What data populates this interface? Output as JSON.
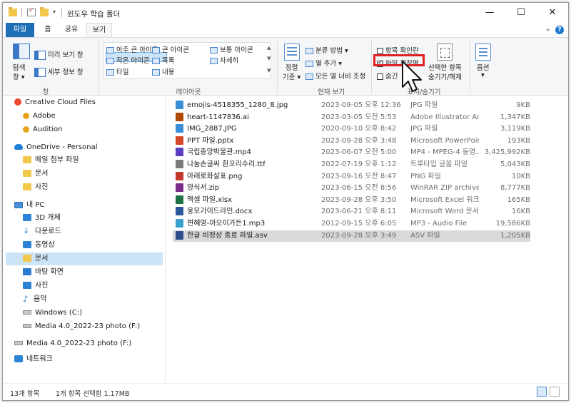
{
  "window": {
    "title": "윈도우 학습 폴더",
    "minimize": "—",
    "maximize": "☐",
    "close": "✕"
  },
  "tabs": [
    {
      "label": "파일"
    },
    {
      "label": "홈"
    },
    {
      "label": "공유"
    },
    {
      "label": "보기"
    }
  ],
  "ribbon": {
    "pane": {
      "nav_pane": "탐색",
      "nav_pane2": "창",
      "preview": "미리 보기 창",
      "details": "세부 정보 창",
      "group": "창"
    },
    "layout": {
      "items": [
        "아주 큰 아이콘",
        "큰 아이콘",
        "보통 아이콘",
        "작은 아이콘",
        "목록",
        "자세히",
        "타일",
        "내용"
      ],
      "selected": "자세히",
      "group": "레이아웃"
    },
    "current_view": {
      "sort": "정렬",
      "sort2": "기준",
      "group_by": "분류 방법",
      "add_col": "열 추가",
      "fit_cols": "모든 열 너비 조정",
      "group": "현재 보기"
    },
    "show_hide": {
      "item_checkboxes": "항목 확인란",
      "file_ext": "파일 확장명",
      "hidden": "숨긴",
      "hide_selected": "선택한 항목",
      "hide_selected2": "숨기기/해제",
      "group": "표시/숨기기",
      "group_partial": "표시",
      "group_partial2": "숨기기"
    },
    "options": "옵션"
  },
  "nav": {
    "items": [
      {
        "label": "Creative Cloud Files"
      },
      {
        "label": "Adobe"
      },
      {
        "label": "Audition"
      },
      {
        "label": "OneDrive - Personal"
      },
      {
        "label": "메일 첨부 파일"
      },
      {
        "label": "문서"
      },
      {
        "label": "사진"
      },
      {
        "label": "내 PC"
      },
      {
        "label": "3D 개체"
      },
      {
        "label": "다운로드"
      },
      {
        "label": "동영상"
      },
      {
        "label": "문서"
      },
      {
        "label": "바탕 화면"
      },
      {
        "label": "사진"
      },
      {
        "label": "음악"
      },
      {
        "label": "Windows (C:)"
      },
      {
        "label": "Media 4.0_2022-23 photo (F:)"
      },
      {
        "label": "Media 4.0_2022-23 photo (F:)"
      },
      {
        "label": "네트워크"
      }
    ]
  },
  "files": [
    {
      "name": "emojis-4518355_1280_8.jpg",
      "date": "2023-09-05 오후 12:36",
      "type": "JPG 파일",
      "size": "9KB",
      "color": "#3b8fd9"
    },
    {
      "name": "heart-1147836.ai",
      "date": "2023-03-05 오전 5:53",
      "type": "Adobe Illustrator Art...",
      "size": "1,347KB",
      "color": "#b04a00"
    },
    {
      "name": "IMG_2887.JPG",
      "date": "2020-09-10 오후 8:42",
      "type": "JPG 파일",
      "size": "3,119KB",
      "color": "#3b8fd9"
    },
    {
      "name": "PPT 파일.pptx",
      "date": "2023-09-28 오후 3:48",
      "type": "Microsoft PowerPoin...",
      "size": "193KB",
      "color": "#d24726"
    },
    {
      "name": "국립중앙박물관.mp4",
      "date": "2023-06-07 오전 5:00",
      "type": "MP4 - MPEG-4 동영...",
      "size": "3,425,992KB",
      "color": "#5a3fc0"
    },
    {
      "name": "나눔손글씨 흰꼬리수리.ttf",
      "date": "2022-07-19 오후 1:12",
      "type": "트루타입 글꼴 파일",
      "size": "5,043KB",
      "color": "#7a7a7a"
    },
    {
      "name": "아래로화살표.png",
      "date": "2023-09-16 오전 8:47",
      "type": "PNG 파일",
      "size": "10KB",
      "color": "#c0392b"
    },
    {
      "name": "양식서.zip",
      "date": "2023-06-15 오전 8:56",
      "type": "WinRAR ZIP archive",
      "size": "8,777KB",
      "color": "#7b2d8b"
    },
    {
      "name": "엑셀 파일.xlsx",
      "date": "2023-09-28 오후 3:50",
      "type": "Microsoft Excel 워크...",
      "size": "165KB",
      "color": "#1e7145"
    },
    {
      "name": "웅모가이드라인.docx",
      "date": "2023-06-21 오후 8:11",
      "type": "Microsoft Word 문서",
      "size": "16KB",
      "color": "#2b579a"
    },
    {
      "name": "편혜영-아오이가든1.mp3",
      "date": "2012-09-15 오후 6:05",
      "type": "MP3 - Audio File",
      "size": "19,586KB",
      "color": "#3aa0d0"
    },
    {
      "name": "한글 비정상 종료 파일.asv",
      "date": "2023-09-28 오후 3:49",
      "type": "ASV 파일",
      "size": "1,205KB",
      "color": "#2c4f8c"
    }
  ],
  "status": {
    "count": "13개 항목",
    "selected": "1개 항목 선택함 1.17MB"
  }
}
